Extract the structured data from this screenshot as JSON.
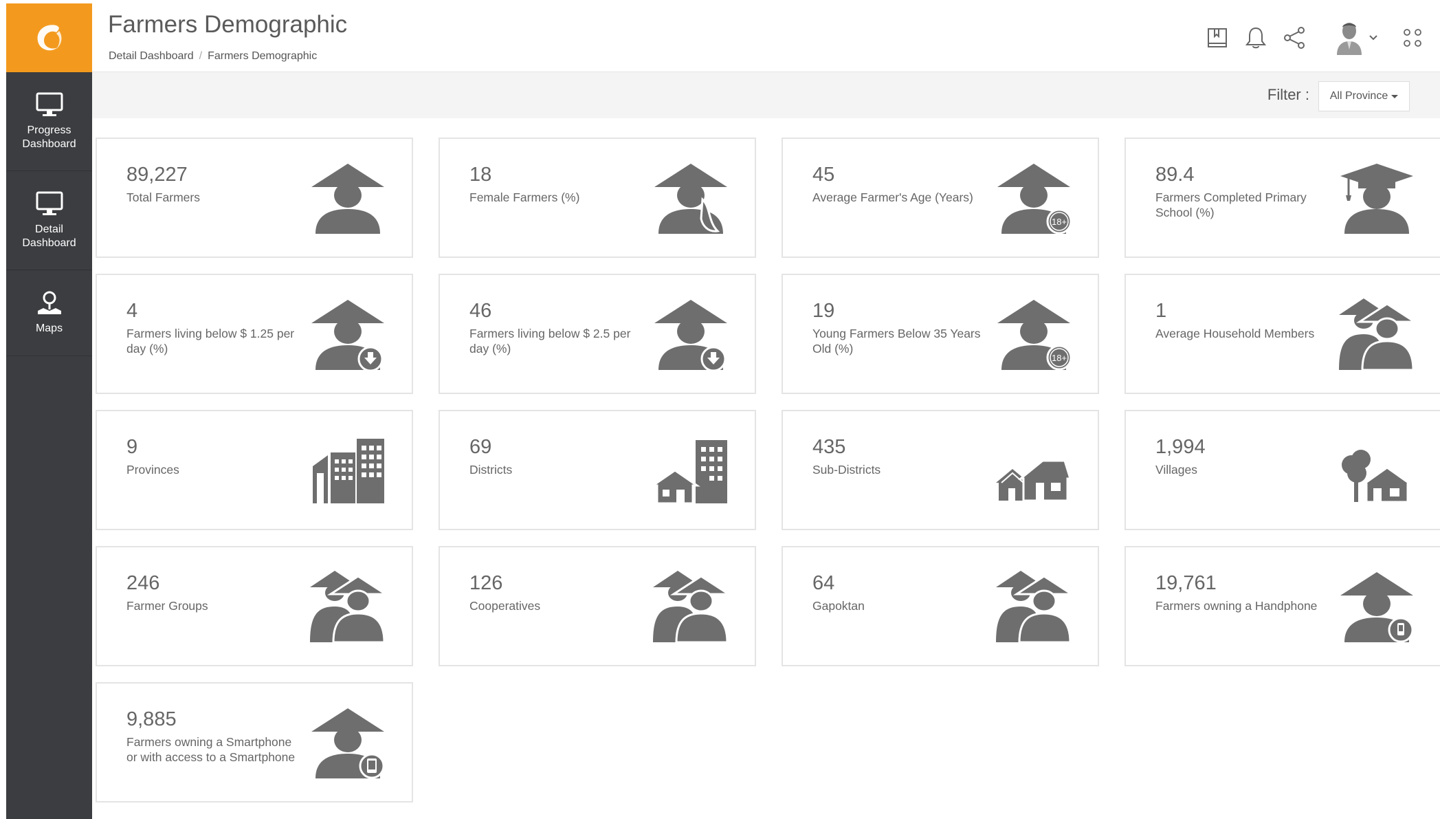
{
  "app": {
    "title": "Farmers Demographic",
    "breadcrumb": [
      "Detail Dashboard",
      "Farmers Demographic"
    ],
    "breadcrumb_sep": "/"
  },
  "sidebar": {
    "items": [
      {
        "label": "Progress Dashboard",
        "icon": "monitor-icon"
      },
      {
        "label": "Detail Dashboard",
        "icon": "monitor-icon"
      },
      {
        "label": "Maps",
        "icon": "map-pin-icon"
      }
    ]
  },
  "header_icons": [
    "book-icon",
    "bell-icon",
    "share-icon",
    "avatar",
    "chevron-down-icon",
    "apps-grid-icon"
  ],
  "filter": {
    "label": "Filter :",
    "selected": "All Province"
  },
  "colors": {
    "brand": "#f39a1e",
    "sidebar": "#3b3d40",
    "icon": "#6e6e6e"
  },
  "cards": [
    {
      "value": "89,227",
      "label": "Total Farmers",
      "icon": "farmer-icon"
    },
    {
      "value": "18",
      "label": "Female Farmers (%)",
      "icon": "female-farmer-icon"
    },
    {
      "value": "45",
      "label": "Average Farmer's Age (Years)",
      "icon": "farmer-age-icon",
      "badge": "18+"
    },
    {
      "value": "89.4",
      "label": "Farmers Completed Primary School (%)",
      "icon": "graduate-farmer-icon"
    },
    {
      "value": "4",
      "label": "Farmers living below $ 1.25 per day (%)",
      "icon": "farmer-poverty-icon"
    },
    {
      "value": "46",
      "label": "Farmers living below $ 2.5 per day (%)",
      "icon": "farmer-poverty-icon"
    },
    {
      "value": "19",
      "label": "Young Farmers Below 35 Years Old (%)",
      "icon": "farmer-age-icon",
      "badge": "18+"
    },
    {
      "value": "1",
      "label": "Average Household Members",
      "icon": "household-icon"
    },
    {
      "value": "9",
      "label": "Provinces",
      "icon": "buildings-icon"
    },
    {
      "value": "69",
      "label": "Districts",
      "icon": "district-icon"
    },
    {
      "value": "435",
      "label": "Sub-Districts",
      "icon": "houses-icon"
    },
    {
      "value": "1,994",
      "label": "Villages",
      "icon": "village-icon"
    },
    {
      "value": "246",
      "label": "Farmer Groups",
      "icon": "group-icon"
    },
    {
      "value": "126",
      "label": "Cooperatives",
      "icon": "group-icon"
    },
    {
      "value": "64",
      "label": "Gapoktan",
      "icon": "group-icon"
    },
    {
      "value": "19,761",
      "label": "Farmers owning a Handphone",
      "icon": "farmer-phone-icon"
    },
    {
      "value": "9,885",
      "label": "Farmers owning a Smartphone or with access to a Smartphone",
      "icon": "farmer-smartphone-icon"
    }
  ]
}
